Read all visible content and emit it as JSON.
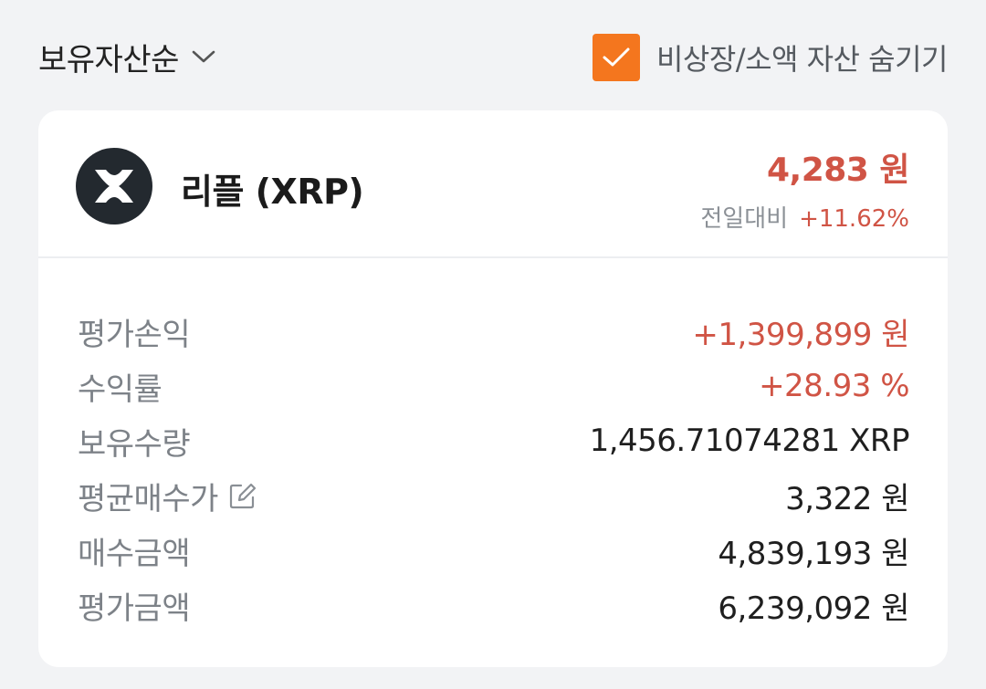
{
  "topbar": {
    "sort_label": "보유자산순",
    "sort_icon": "chevron-down-icon",
    "hide_checkbox_checked": true,
    "hide_label": "비상장/소액 자산 숨기기",
    "accent_color": "#f4761e"
  },
  "asset": {
    "logo_icon": "xrp-logo-icon",
    "name": "리플 (XRP)",
    "price": "4,283 원",
    "change_label": "전일대비",
    "change_value": "+11.62%",
    "up_color": "#d05445"
  },
  "details": [
    {
      "label": "평가손익",
      "value": "+1,399,899 원",
      "highlight": true
    },
    {
      "label": "수익률",
      "value": "+28.93 %",
      "highlight": true
    },
    {
      "label": "보유수량",
      "value": "1,456.71074281 XRP",
      "highlight": false
    },
    {
      "label": "평균매수가",
      "value": "3,322 원",
      "highlight": false,
      "icon": "edit-icon"
    },
    {
      "label": "매수금액",
      "value": "4,839,193 원",
      "highlight": false
    },
    {
      "label": "평가금액",
      "value": "6,239,092 원",
      "highlight": false
    }
  ]
}
